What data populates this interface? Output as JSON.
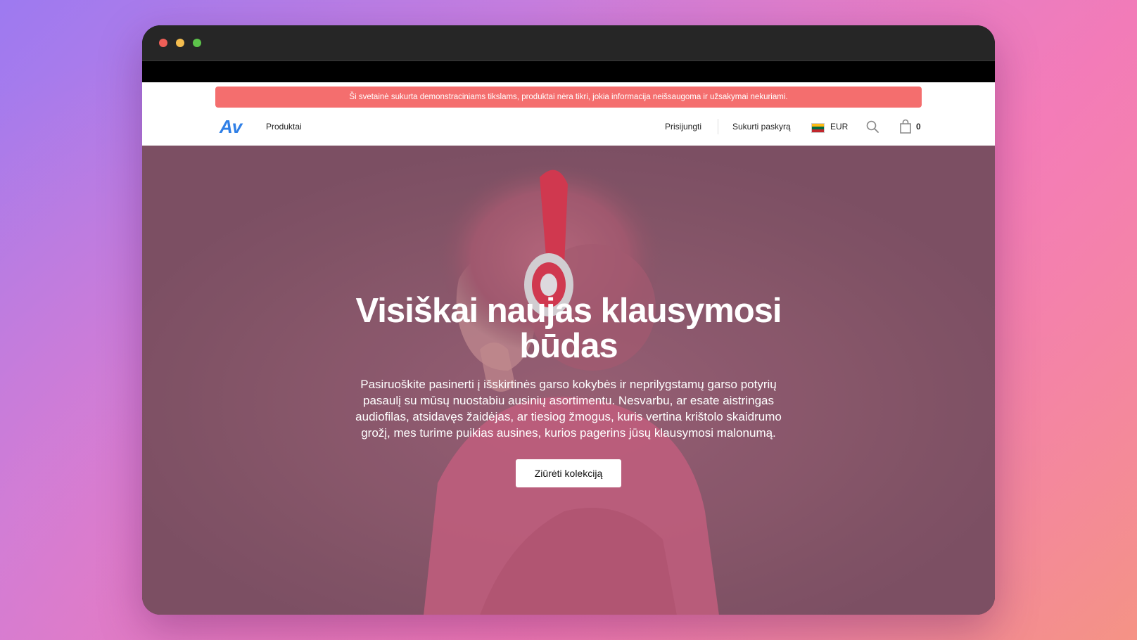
{
  "notice": {
    "text": "Ši svetainė sukurta demonstraciniams tikslams, produktai nėra tikri, jokia informacija neišsaugoma ir užsakymai nekuriami."
  },
  "nav": {
    "logo": "Av",
    "products": "Produktai",
    "login": "Prisijungti",
    "signup": "Sukurti paskyrą",
    "currency": "EUR",
    "cart_count": "0"
  },
  "hero": {
    "title": "Visiškai naujas klausymosi būdas",
    "description": "Pasiruoškite pasinerti į išskirtinės garso kokybės ir neprilygstamų garso potyrių pasaulį su mūsų nuostabiu ausinių asortimentu. Nesvarbu, ar esate aistringas audiofilas, atsidavęs žaidėjas, ar tiesiog žmogus, kuris vertina krištolo skaidrumo grožį, mes turime puikias ausines, kurios pagerins jūsų klausymosi malonumą.",
    "cta": "Ziūrėti kolekciją"
  },
  "colors": {
    "accent": "#2f7fe6",
    "notice_bg": "#f46e6e",
    "hero_bg": "#835466"
  },
  "icons": [
    "search-icon",
    "shopping-bag-icon",
    "lithuania-flag-icon"
  ]
}
